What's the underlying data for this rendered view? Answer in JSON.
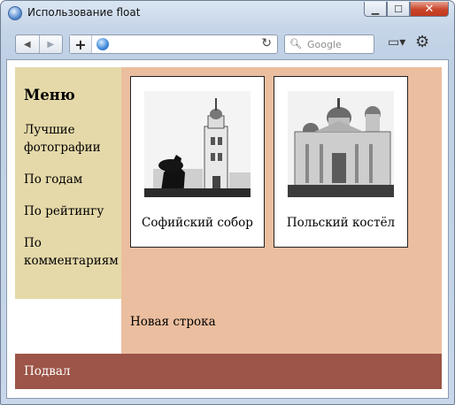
{
  "window": {
    "title": "Использование float"
  },
  "toolbar": {
    "search_placeholder": "Google",
    "back_icon": "arrow-left-icon",
    "forward_icon": "arrow-right-icon",
    "add_icon": "plus-icon",
    "reload_icon": "reload-icon",
    "page_icon": "page-menu-icon",
    "tools_icon": "gear-icon"
  },
  "sidebar": {
    "heading": "Меню",
    "items": [
      {
        "label": "Лучшие фотографии"
      },
      {
        "label": "По годам"
      },
      {
        "label": "По рейтингу"
      },
      {
        "label": "По комментариям"
      }
    ]
  },
  "content": {
    "cards": [
      {
        "caption": "Софийский собор"
      },
      {
        "caption": "Польский костёл"
      }
    ],
    "new_line": "Новая строка"
  },
  "footer": {
    "text": "Подвал"
  },
  "colors": {
    "sidebar_bg": "#e5d9a9",
    "content_bg": "#ebbe9f",
    "footer_bg": "#9c5548",
    "footer_text": "#ffffff"
  }
}
